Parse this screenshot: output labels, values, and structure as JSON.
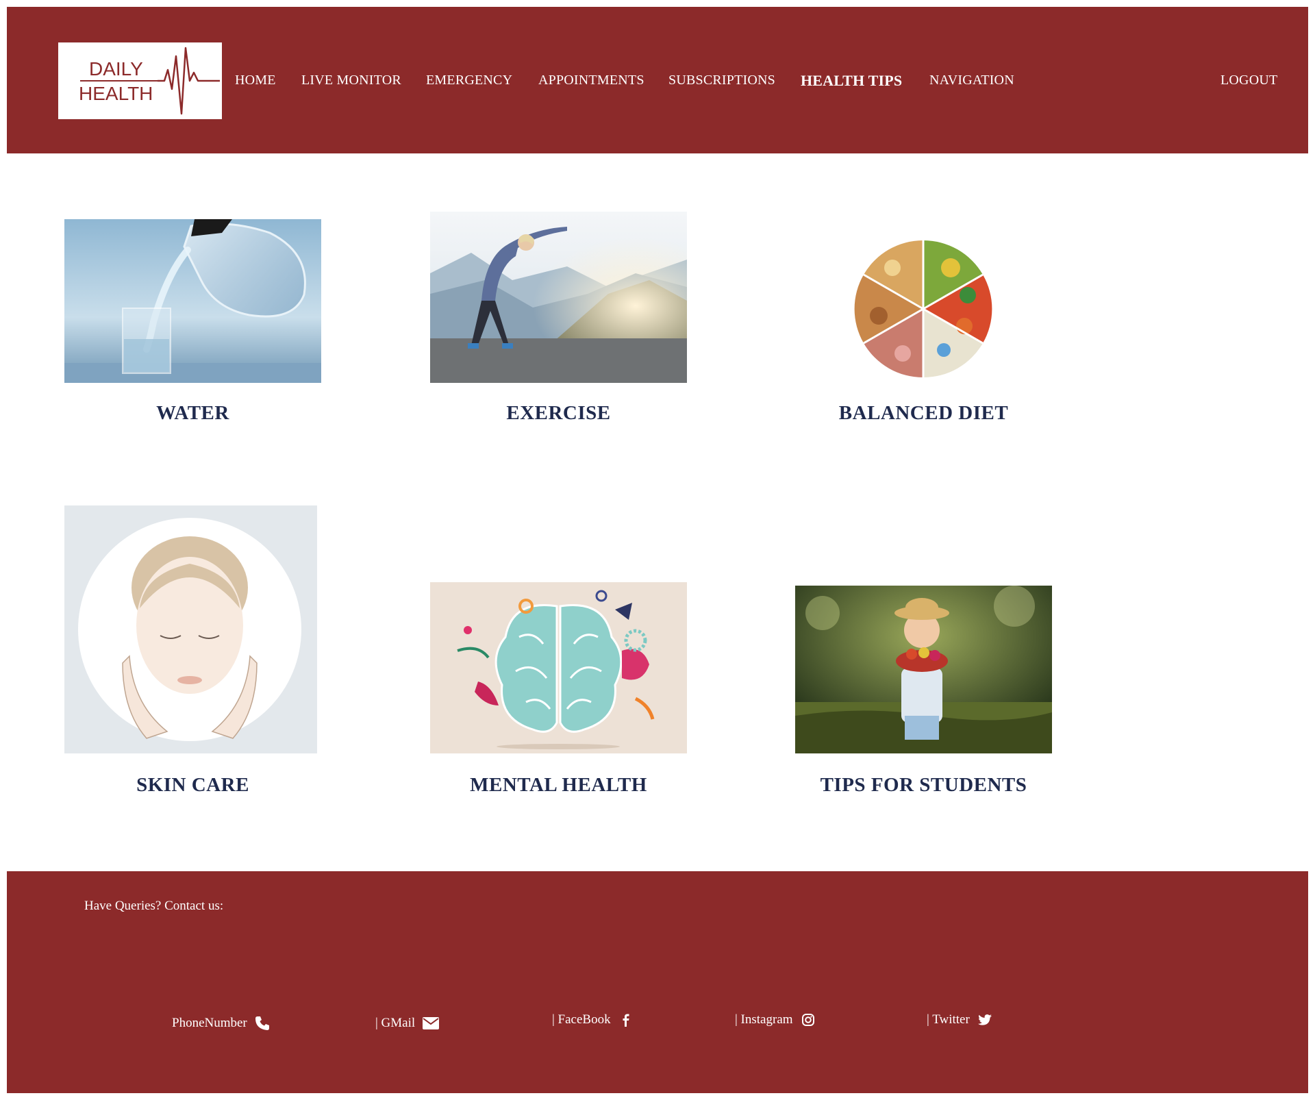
{
  "header": {
    "logo": {
      "line1": "DAILY",
      "line2": "HEALTH"
    },
    "nav": [
      {
        "id": "home",
        "label": "HOME"
      },
      {
        "id": "live-monitor",
        "label": "LIVE MONITOR"
      },
      {
        "id": "emergency",
        "label": "EMERGENCY"
      },
      {
        "id": "appointments",
        "label": "APPOINTMENTS"
      },
      {
        "id": "subscriptions",
        "label": "SUBSCRIPTIONS"
      },
      {
        "id": "health-tips",
        "label": "HEALTH TIPS",
        "active": true
      },
      {
        "id": "navigation",
        "label": "NAVIGATION"
      }
    ],
    "logout": "LOGOUT"
  },
  "cards": [
    {
      "title": "WATER",
      "icon": "water-pouring-image"
    },
    {
      "title": "EXERCISE",
      "icon": "exercise-stretching-image"
    },
    {
      "title": "BALANCED DIET",
      "icon": "food-wheel-image"
    },
    {
      "title": "SKIN CARE",
      "icon": "face-care-image"
    },
    {
      "title": "MENTAL HEALTH",
      "icon": "brain-illustration-image"
    },
    {
      "title": "TIPS FOR STUDENTS",
      "icon": "child-with-fruit-image"
    }
  ],
  "footer": {
    "queries": "Have Queries? Contact us:",
    "contacts": [
      {
        "label": "PhoneNumber",
        "icon": "phone-icon"
      },
      {
        "label": "| GMail",
        "icon": "mail-icon"
      },
      {
        "label": "| FaceBook",
        "icon": "facebook-icon"
      },
      {
        "label": "| Instagram",
        "icon": "instagram-icon"
      },
      {
        "label": "| Twitter",
        "icon": "twitter-icon"
      }
    ]
  },
  "colors": {
    "brand": "#8c2a2a",
    "title": "#1f2a4d",
    "white": "#ffffff"
  }
}
